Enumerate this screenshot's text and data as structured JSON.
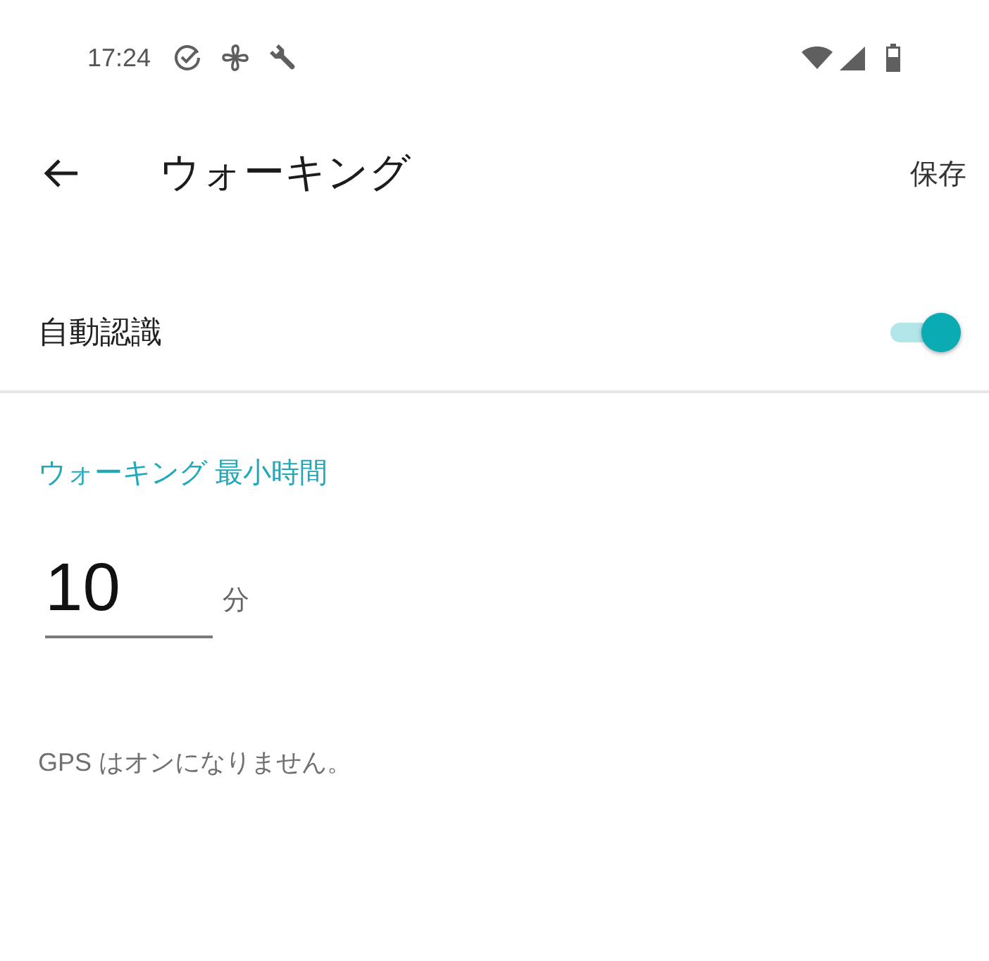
{
  "status_bar": {
    "time": "17:24"
  },
  "app_bar": {
    "title": "ウォーキング",
    "action": "保存"
  },
  "settings": [
    {
      "kind": "toggle",
      "label": "自動認識",
      "on": true
    }
  ],
  "min_duration": {
    "label": "ウォーキング 最小時間",
    "value": "10",
    "unit": "分"
  },
  "note": "GPS はオンになりません。"
}
